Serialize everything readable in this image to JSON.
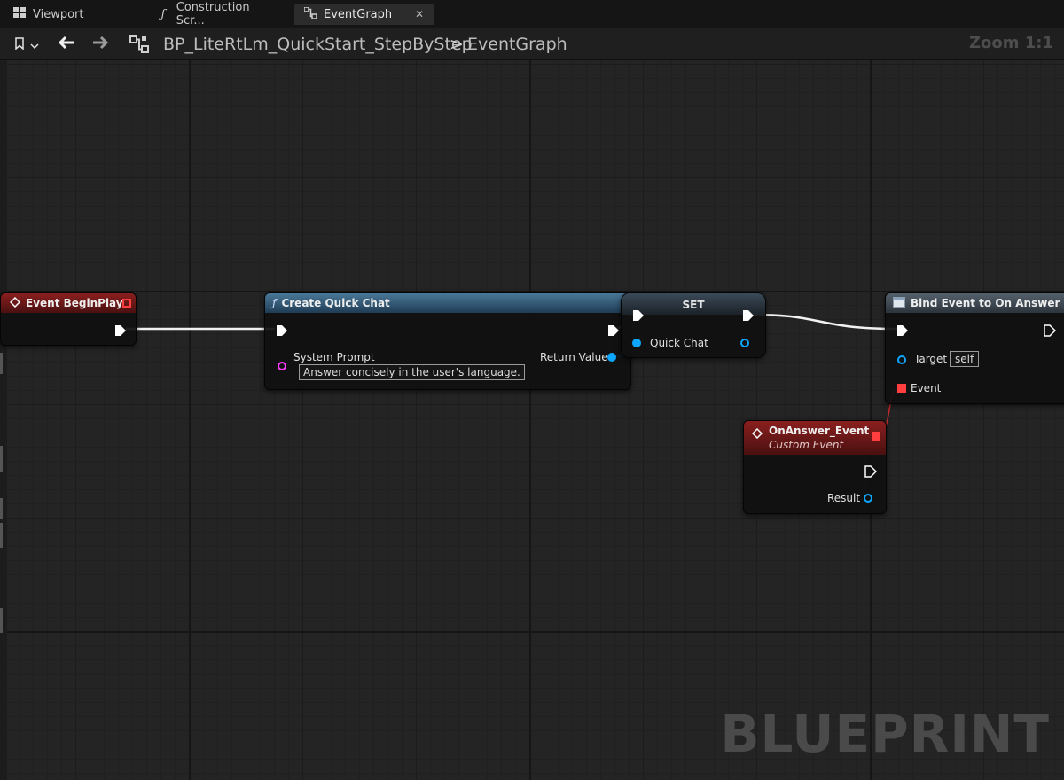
{
  "tabs": [
    {
      "label": "Viewport",
      "icon": "viewport-icon"
    },
    {
      "label": "Construction Scr...",
      "icon": "function-icon"
    },
    {
      "label": "EventGraph",
      "icon": "graph-icon",
      "active": true
    }
  ],
  "toolbar": {
    "breadcrumb_root": "BP_LiteRtLm_QuickStart_StepByStep",
    "breadcrumb_separator": ">",
    "breadcrumb_current": "EventGraph",
    "zoom": "Zoom 1:1"
  },
  "nodes": {
    "begin_play": {
      "title": "Event BeginPlay"
    },
    "create_quick_chat": {
      "title": "Create Quick Chat",
      "system_prompt_label": "System Prompt",
      "system_prompt_value": "Answer concisely in the user's language.",
      "return_value_label": "Return Value"
    },
    "set": {
      "title": "SET",
      "var_label": "Quick Chat"
    },
    "bind_event": {
      "title": "Bind Event to On Answer",
      "target_label": "Target",
      "target_value": "self",
      "event_label": "Event"
    },
    "on_answer": {
      "title": "OnAnswer_Event",
      "subtitle": "Custom Event",
      "result_label": "Result"
    }
  },
  "watermark": "BLUEPRINT",
  "colors": {
    "exec": "#ffffff",
    "object_pin": "#0ea7ff",
    "string_pin": "#ff3cff",
    "delegate_pin": "#ff3f3f",
    "event_header": "#8a1f1f",
    "function_header": "#4a7898"
  }
}
